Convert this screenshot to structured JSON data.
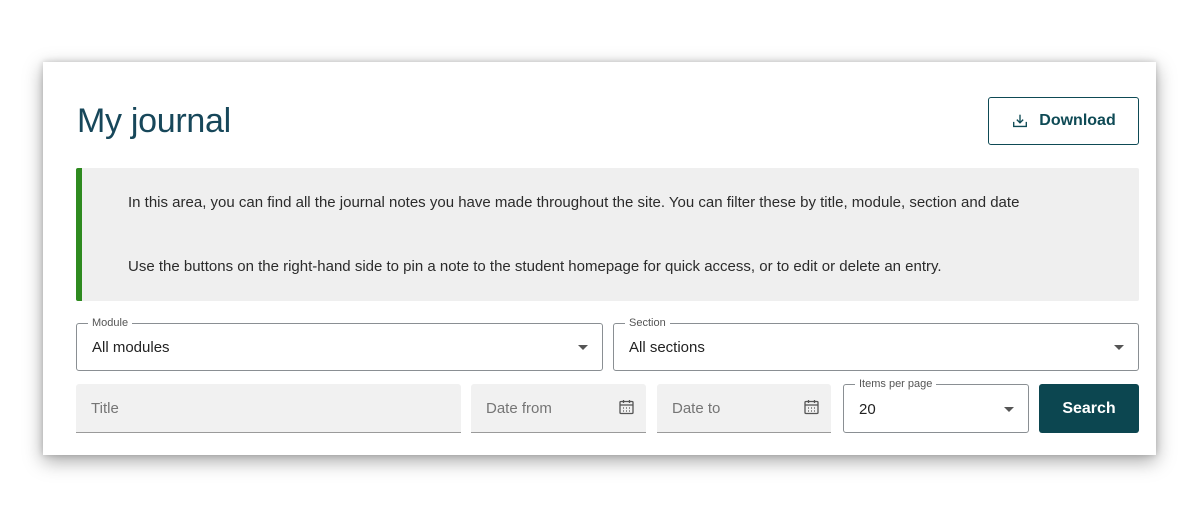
{
  "header": {
    "title": "My journal",
    "download_label": "Download"
  },
  "info": {
    "paragraph1": "In this area, you can find all the journal notes you have made throughout the site. You can filter these by title, module, section and date",
    "paragraph2": "Use the buttons on the right-hand side to pin a note to the student homepage for quick access, or to edit or delete an entry."
  },
  "filters": {
    "module": {
      "label": "Module",
      "value": "All modules"
    },
    "section": {
      "label": "Section",
      "value": "All sections"
    },
    "title": {
      "placeholder": "Title"
    },
    "date_from": {
      "placeholder": "Date from"
    },
    "date_to": {
      "placeholder": "Date to"
    },
    "items_per_page": {
      "label": "Items per page",
      "value": "20"
    },
    "search_label": "Search"
  },
  "colors": {
    "accent": "#0c4650",
    "title": "#17475a",
    "info_border": "#2e8a1f",
    "info_bg": "#efefef"
  },
  "icons": [
    "download-icon",
    "calendar-icon",
    "chevron-down-icon"
  ]
}
